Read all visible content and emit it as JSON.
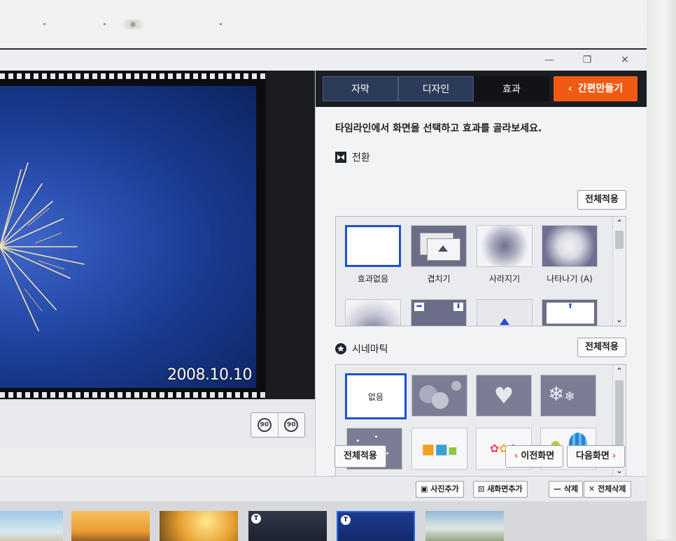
{
  "window": {
    "minimize": "—",
    "restore": "❐",
    "close": "✕"
  },
  "preview": {
    "date_stamp": "2008.10.10",
    "rotate_left": "90",
    "rotate_right": "90"
  },
  "tabs": [
    {
      "label": "자막",
      "active": false
    },
    {
      "label": "디자인",
      "active": false
    },
    {
      "label": "효과",
      "active": true
    }
  ],
  "easy_make": {
    "label": "간편만들기",
    "icon": "chevron-left-icon",
    "color": "#f05a14"
  },
  "instruction": "타임라인에서 화면을 선택하고 효과를 골라보세요.",
  "transition": {
    "title": "전환",
    "icon": "bowtie-icon",
    "apply_label": "전체적용",
    "tiles": [
      {
        "label": "효과없음",
        "selected": true
      },
      {
        "label": "겹치기"
      },
      {
        "label": "사라지기"
      },
      {
        "label": "나타나기 (A)"
      }
    ]
  },
  "cinematic": {
    "title": "시네마틱",
    "icon": "star-badge-icon",
    "apply_label": "전체적용",
    "tiles": [
      {
        "label": "없음",
        "selected": true
      }
    ]
  },
  "footer": {
    "apply_all": "전체적용",
    "prev": "이전화면",
    "next": "다음화면"
  },
  "toolbar": {
    "add_photo": "사진추가",
    "add_screen": "새화면추가",
    "delete": "삭제",
    "delete_all": "전체삭제"
  },
  "filmstrip": {
    "badge": "T"
  },
  "colors": {
    "accent": "#f05a14",
    "selection": "#1d50d8",
    "tab_bg": "#2d3b5a"
  }
}
